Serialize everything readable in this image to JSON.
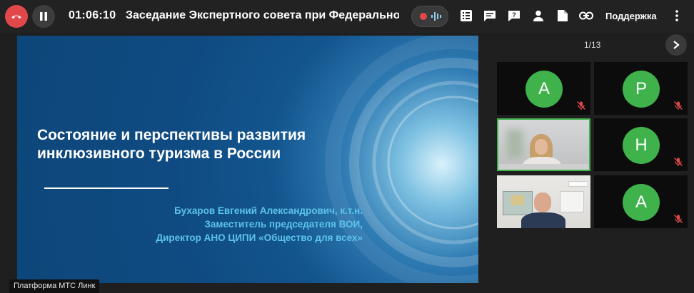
{
  "app": {
    "timer": "01:06:10",
    "meeting_title": "Заседание Экспертного совета при Федеральном р",
    "support_label": "Поддержка",
    "platform_watermark": "Платформа МТС Линк"
  },
  "colors": {
    "hangup": "#e2484a",
    "avatar": "#3fb24b",
    "active_speaker_border": "#3fb24b",
    "slide_accent_text": "#5cc3ea",
    "slide_background": "#0f4b82"
  },
  "toolbar_icons": [
    "hangup-icon",
    "pause-icon",
    "record-icon",
    "audio-wave-icon",
    "checklist-icon",
    "chat-icon",
    "question-icon",
    "person-icon",
    "document-icon",
    "link-icon",
    "more-vertical-icon"
  ],
  "slide": {
    "title_line1": "Состояние и перспективы развития",
    "title_line2": "инклюзивного туризма в России",
    "author_line1": "Бухаров Евгений Александрович, к.т.н.",
    "author_line2": "Заместитель председателя ВОИ,",
    "author_line3": "Директор АНО ЦИПИ «Общество для всех»"
  },
  "participants": {
    "page_indicator": "1/13",
    "tiles": [
      {
        "type": "avatar",
        "initial": "А",
        "muted": true
      },
      {
        "type": "avatar",
        "initial": "Р",
        "muted": true
      },
      {
        "type": "video",
        "active": true,
        "muted": false
      },
      {
        "type": "avatar",
        "initial": "Н",
        "muted": true
      },
      {
        "type": "video",
        "active": false,
        "muted": false
      },
      {
        "type": "avatar",
        "initial": "А",
        "muted": true
      }
    ]
  }
}
